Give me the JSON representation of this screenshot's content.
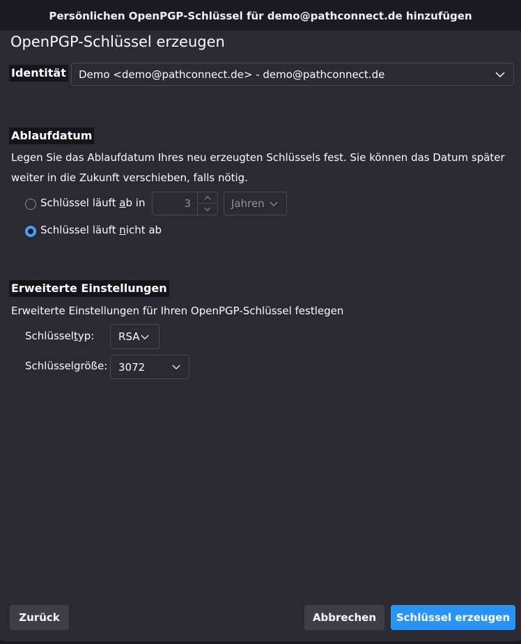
{
  "window": {
    "title": "Persönlichen OpenPGP-Schlüssel für demo@pathconnect.de hinzufügen"
  },
  "dialog": {
    "heading": "OpenPGP-Schlüssel erzeugen",
    "identity": {
      "label": "Identität",
      "selected": "Demo <demo@pathconnect.de> - demo@pathconnect.de"
    },
    "expiry": {
      "label": "Ablaufdatum",
      "description_line1": "Legen Sie das Ablaufdatum Ihres neu erzeugten Schlüssels fest. Sie können das Datum später",
      "description_line2": "weiter in die Zukunft verschieben, falls nötig.",
      "option_expires": {
        "pre": "Schlüssel läuft ",
        "accel": "a",
        "post": "b in",
        "selected": false
      },
      "amount": "3",
      "unit": "Jahren",
      "option_never": {
        "pre": "Schlüssel läuft ",
        "accel": "n",
        "post": "icht ab",
        "selected": true
      }
    },
    "advanced": {
      "label": "Erweiterte Einstellungen",
      "description": "Erweiterte Einstellungen für Ihren OpenPGP-Schlüssel festlegen",
      "key_type": {
        "label_pre": "Schlüssel",
        "label_accel": "t",
        "label_post": "yp:",
        "value": "RSA"
      },
      "key_size": {
        "label": "Schlüsselgröße:",
        "value": "3072"
      }
    },
    "buttons": {
      "back": "Zurück",
      "cancel": "Abbrechen",
      "generate": "Schlüssel erzeugen"
    }
  },
  "colors": {
    "accent": "#2a94f5",
    "background": "#2b2a33",
    "titlebar": "#1c1b22"
  }
}
